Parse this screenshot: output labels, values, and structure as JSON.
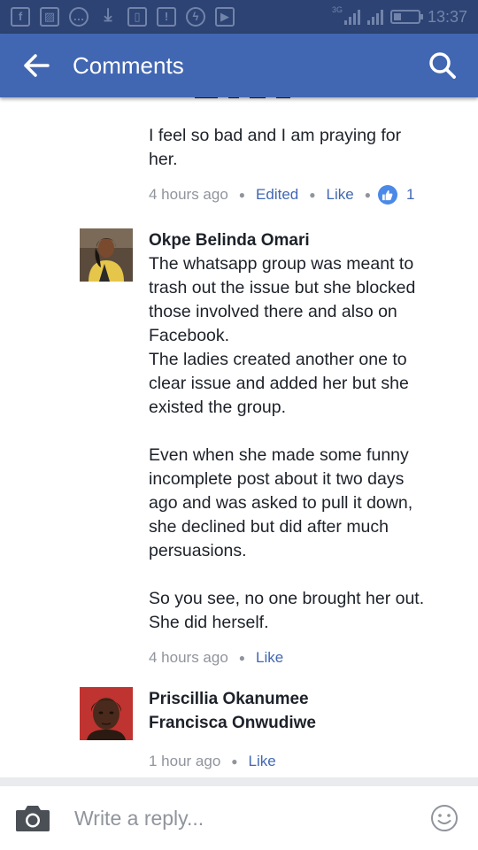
{
  "status_bar": {
    "time": "13:37",
    "network": "3G",
    "icons": [
      "facebook-icon",
      "image-icon",
      "chat-icon",
      "download-icon",
      "document-icon",
      "alert-icon",
      "messenger-icon",
      "video-icon"
    ]
  },
  "header": {
    "title": "Comments",
    "back_icon": "arrow-left-icon",
    "search_icon": "search-icon"
  },
  "comments": [
    {
      "text": "I feel so bad and I am praying for\nher.",
      "time": "4 hours ago",
      "edited": "Edited",
      "like": "Like",
      "like_count": "1"
    },
    {
      "author": "Okpe Belinda Omari",
      "text": "The whatsapp group was meant to\ntrash out the issue but she blocked\nthose involved there and also on\nFacebook.\nThe ladies created another one to\nclear issue and added her but she\nexisted the group.\n\nEven when she made some funny\nincomplete post about it two days\nago and was asked to pull it down,\nshe declined but did after much\npersuasions.\n\nSo you see, no one brought her out.\nShe did herself.",
      "time": "4 hours ago",
      "like": "Like"
    },
    {
      "author": "Priscillia Okanumee\nFrancisca Onwudiwe",
      "time": "1 hour ago",
      "like": "Like"
    }
  ],
  "composer": {
    "placeholder": "Write a reply...",
    "camera_icon": "camera-icon",
    "emoji_icon": "smiley-icon"
  },
  "colors": {
    "status_bar": "#2d4373",
    "app_bar": "#4267b2",
    "link": "#4267b2",
    "meta_gray": "#90949c",
    "like_badge": "#4b89e8"
  }
}
